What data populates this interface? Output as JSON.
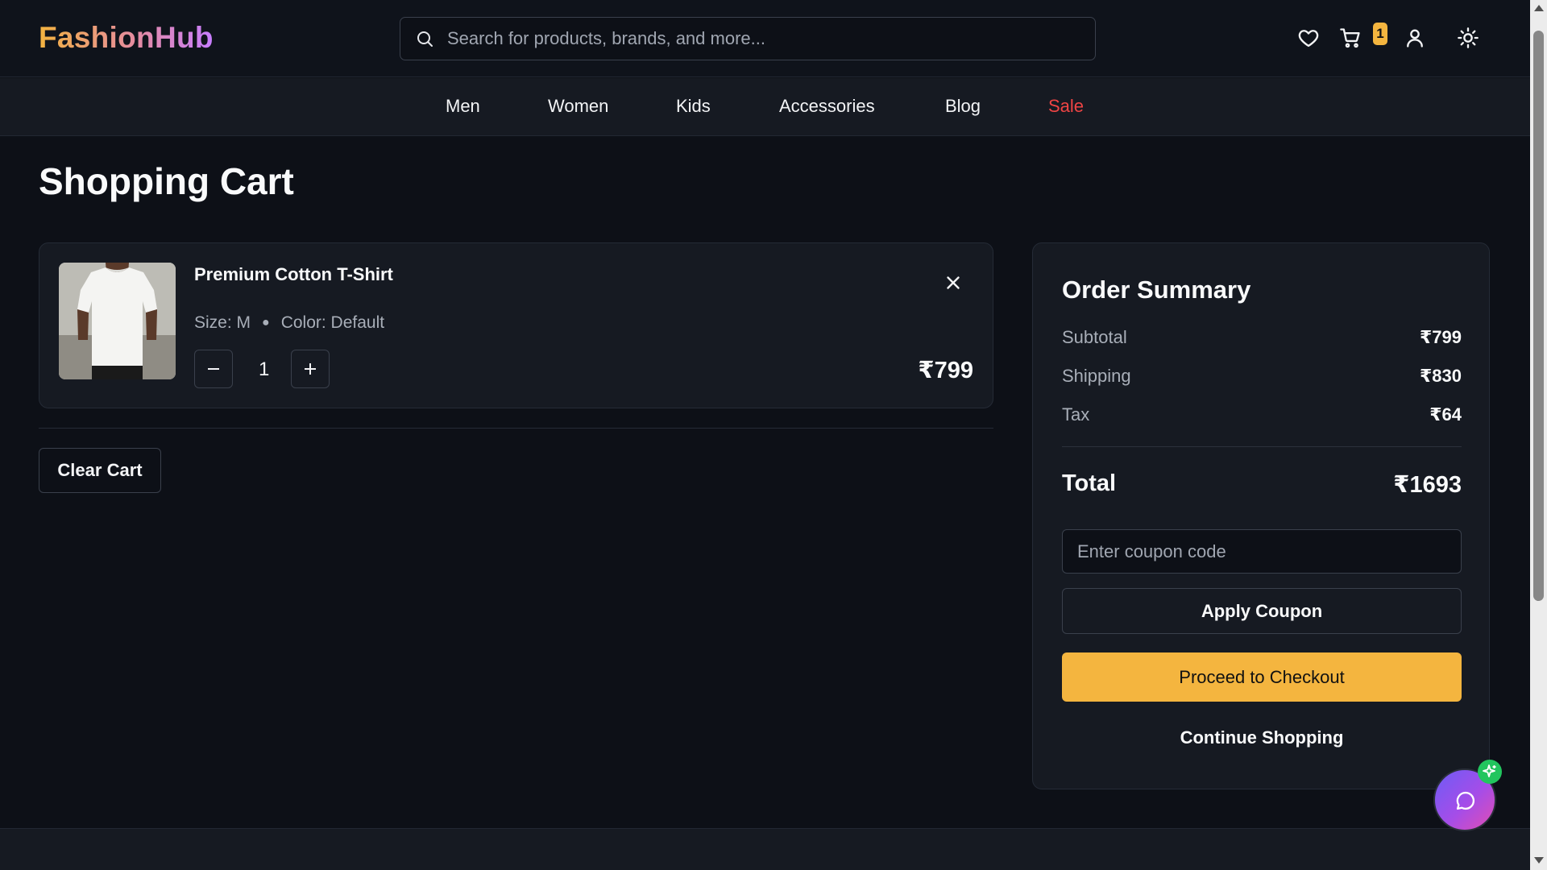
{
  "brand": {
    "logo": "FashionHub"
  },
  "search": {
    "placeholder": "Search for products, brands, and more...",
    "value": ""
  },
  "header": {
    "icons": [
      "heart-icon",
      "cart-icon",
      "user-icon",
      "sun-icon"
    ],
    "cart_count": "1"
  },
  "nav": {
    "items": [
      {
        "label": "Men"
      },
      {
        "label": "Women"
      },
      {
        "label": "Kids"
      },
      {
        "label": "Accessories"
      },
      {
        "label": "Blog"
      },
      {
        "label": "Sale",
        "color": "#ef4444"
      }
    ]
  },
  "page": {
    "title": "Shopping Cart"
  },
  "cart": {
    "items": [
      {
        "name": "Premium Cotton T-Shirt",
        "size": "Size: M",
        "color": "Color: Default",
        "quantity": "1",
        "price": "₹799"
      }
    ],
    "clear_label": "Clear Cart"
  },
  "summary": {
    "title": "Order Summary",
    "subtotal_label": "Subtotal",
    "subtotal_value": "₹799",
    "shipping_label": "Shipping",
    "shipping_value": "₹830",
    "tax_label": "Tax",
    "tax_value": "₹64",
    "total_label": "Total",
    "total_value": "₹1693",
    "coupon_placeholder": "Enter coupon code",
    "coupon_value": "",
    "apply_label": "Apply Coupon",
    "checkout_label": "Proceed to Checkout",
    "continue_label": "Continue Shopping"
  },
  "colors": {
    "accent": "#f4b53f",
    "background": "#0d1017",
    "panel": "#161a22",
    "sale": "#ef4444",
    "chat_gradient_start": "#6d5cf6",
    "chat_gradient_end": "#e24db3",
    "sparkle_badge": "#22c55e"
  }
}
